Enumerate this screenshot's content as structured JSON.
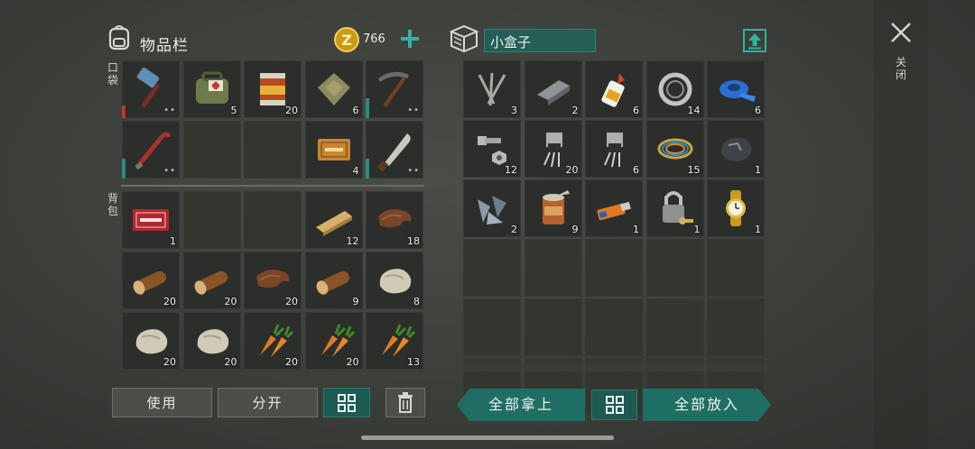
{
  "left_panel": {
    "title": "物品栏",
    "coins": "766",
    "pocket_label": "口袋",
    "backpack_label": "背包",
    "pocket": [
      {
        "name": "hammer-icon",
        "qty": "",
        "durability": "red"
      },
      {
        "name": "medkit-bag-icon",
        "qty": "5"
      },
      {
        "name": "canned-food-icon",
        "qty": "20"
      },
      {
        "name": "cloth-rag-icon",
        "qty": "6"
      },
      {
        "name": "pickaxe-icon",
        "qty": "",
        "durability": "teal"
      },
      {
        "name": "crowbar-icon",
        "qty": "",
        "durability": "teal"
      },
      {
        "name": "",
        "qty": ""
      },
      {
        "name": "",
        "qty": ""
      },
      {
        "name": "coupon-ticket-icon",
        "qty": "4"
      },
      {
        "name": "machete-icon",
        "qty": "",
        "durability": "teal"
      }
    ],
    "backpack": [
      {
        "name": "coupon-red-icon",
        "qty": "1"
      },
      {
        "name": "",
        "qty": ""
      },
      {
        "name": "",
        "qty": ""
      },
      {
        "name": "wood-plank-icon",
        "qty": "12"
      },
      {
        "name": "leather-icon",
        "qty": "18"
      },
      {
        "name": "log-icon",
        "qty": "20"
      },
      {
        "name": "log-icon",
        "qty": "20"
      },
      {
        "name": "leather-icon",
        "qty": "20"
      },
      {
        "name": "log-icon",
        "qty": "9"
      },
      {
        "name": "stone-icon",
        "qty": "8"
      },
      {
        "name": "stone-icon",
        "qty": "20"
      },
      {
        "name": "stone-icon",
        "qty": "20"
      },
      {
        "name": "carrot-icon",
        "qty": "20"
      },
      {
        "name": "carrot-icon",
        "qty": "20"
      },
      {
        "name": "carrot-icon",
        "qty": "13"
      }
    ],
    "buttons": {
      "use": "使用",
      "split": "分开"
    }
  },
  "right_panel": {
    "container_name": "小盒子",
    "items": [
      {
        "name": "nails-icon",
        "qty": "3"
      },
      {
        "name": "metal-bar-icon",
        "qty": "2"
      },
      {
        "name": "glue-icon",
        "qty": "6"
      },
      {
        "name": "bearing-ring-icon",
        "qty": "14"
      },
      {
        "name": "tape-icon",
        "qty": "6"
      },
      {
        "name": "bolt-nut-icon",
        "qty": "12"
      },
      {
        "name": "transistor-icon",
        "qty": "20"
      },
      {
        "name": "transistor-icon",
        "qty": "6"
      },
      {
        "name": "wire-coil-icon",
        "qty": "15"
      },
      {
        "name": "coal-ore-icon",
        "qty": "1"
      },
      {
        "name": "metal-scrap-icon",
        "qty": "2"
      },
      {
        "name": "tin-can-icon",
        "qty": "9"
      },
      {
        "name": "usb-drive-icon",
        "qty": "1"
      },
      {
        "name": "padlock-key-icon",
        "qty": "1"
      },
      {
        "name": "wristwatch-icon",
        "qty": "1"
      }
    ],
    "buttons": {
      "take_all": "全部拿上",
      "put_all": "全部放入"
    }
  },
  "close": {
    "label": "关闭"
  }
}
